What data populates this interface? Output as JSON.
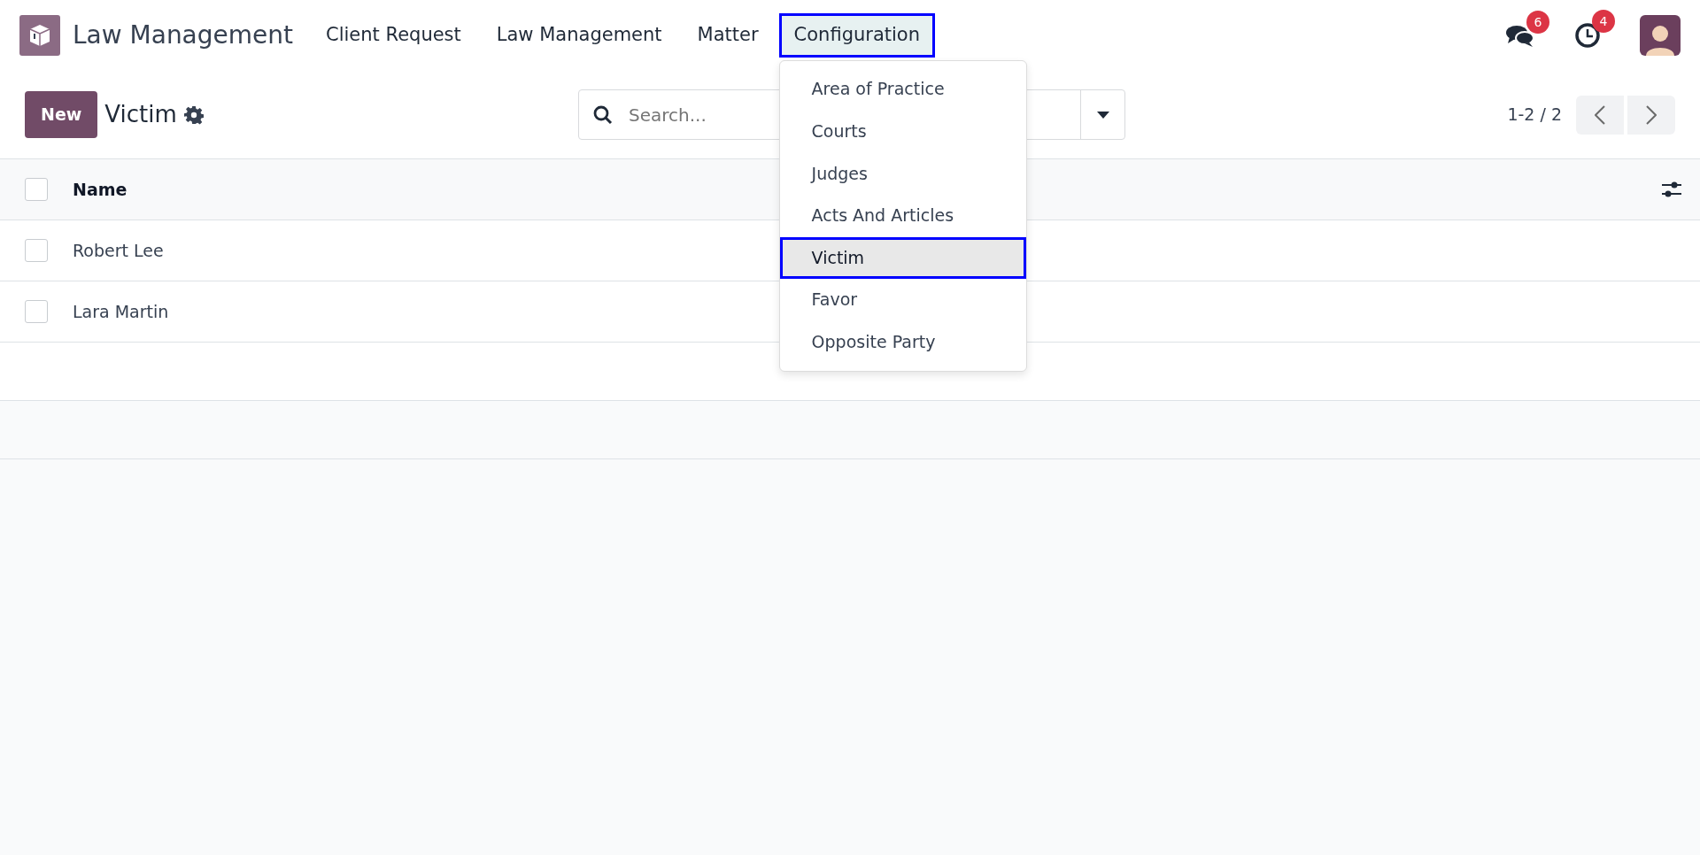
{
  "app": {
    "name": "Law Management"
  },
  "menu": [
    {
      "label": "Client Request",
      "selected": false
    },
    {
      "label": "Law Management",
      "selected": false
    },
    {
      "label": "Matter",
      "selected": false
    },
    {
      "label": "Configuration",
      "selected": true,
      "expanded": true,
      "items": [
        {
          "label": "Area of Practice",
          "selected": false
        },
        {
          "label": "Courts",
          "selected": false
        },
        {
          "label": "Judges",
          "selected": false
        },
        {
          "label": "Acts And Articles",
          "selected": false
        },
        {
          "label": "Victim",
          "selected": true
        },
        {
          "label": "Favor",
          "selected": false
        },
        {
          "label": "Opposite Party",
          "selected": false
        }
      ]
    }
  ],
  "systray": {
    "messages_badge": "6",
    "activities_badge": "4"
  },
  "control_panel": {
    "new_button": "New",
    "title": "Victim",
    "search": {
      "placeholder": "Search..."
    },
    "pager": "1-2 / 2"
  },
  "table": {
    "header_checked": false,
    "columns": [
      "Name"
    ],
    "rows": [
      {
        "name": "Robert Lee",
        "checked": false
      },
      {
        "name": "Lara Martin",
        "checked": false
      }
    ]
  }
}
